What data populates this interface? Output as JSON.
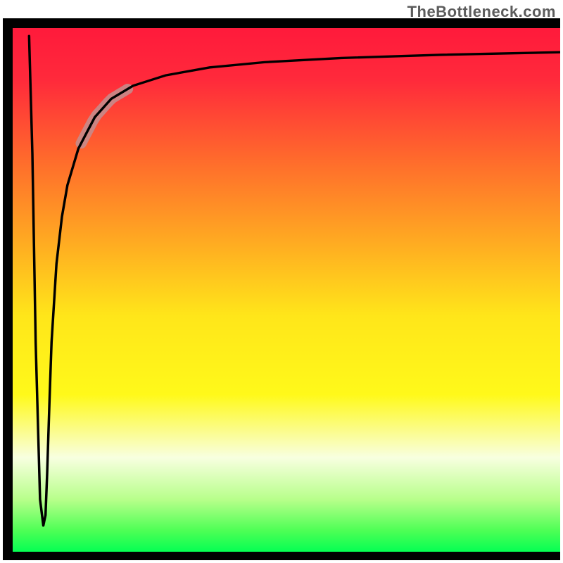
{
  "watermark": "TheBottleneck.com",
  "chart_data": {
    "type": "line",
    "title": "",
    "xlabel": "",
    "ylabel": "",
    "xlim": [
      0,
      100
    ],
    "ylim": [
      0,
      100
    ],
    "grid": false,
    "legend": false,
    "gradient_stops": [
      {
        "offset": 0.0,
        "color": "#ff1a3b"
      },
      {
        "offset": 0.1,
        "color": "#ff2a3b"
      },
      {
        "offset": 0.25,
        "color": "#ff6a2c"
      },
      {
        "offset": 0.4,
        "color": "#ffa722"
      },
      {
        "offset": 0.55,
        "color": "#ffe61a"
      },
      {
        "offset": 0.7,
        "color": "#fff91a"
      },
      {
        "offset": 0.82,
        "color": "#f8ffe0"
      },
      {
        "offset": 0.9,
        "color": "#b8ff8b"
      },
      {
        "offset": 0.96,
        "color": "#4dff55"
      },
      {
        "offset": 1.0,
        "color": "#05ff53"
      }
    ],
    "series": [
      {
        "name": "bottleneck-curve",
        "x": [
          3.0,
          3.6,
          4.2,
          5.0,
          5.6,
          6.0,
          6.3,
          6.7,
          7.1,
          8.0,
          9.0,
          10.0,
          12.0,
          15.0,
          18.0,
          22.0,
          28.0,
          36.0,
          46.0,
          60.0,
          78.0,
          100.0
        ],
        "y": [
          98.5,
          76.0,
          40.0,
          10.0,
          5.0,
          7.0,
          15.0,
          28.0,
          40.0,
          55.0,
          64.0,
          70.0,
          77.0,
          83.0,
          86.5,
          89.0,
          91.0,
          92.5,
          93.5,
          94.3,
          94.9,
          95.4
        ]
      }
    ],
    "highlight_segment": {
      "x_range": [
        12.5,
        21.0
      ],
      "color": "#c78b8b",
      "width": 14
    }
  }
}
